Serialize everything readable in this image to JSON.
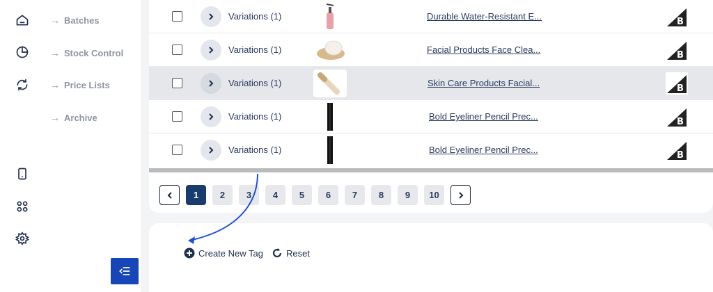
{
  "sidebar": {
    "items": [
      {
        "label": "Batches"
      },
      {
        "label": "Stock Control"
      },
      {
        "label": "Price Lists"
      },
      {
        "label": "Archive"
      }
    ],
    "arrow": "→"
  },
  "table": {
    "rows": [
      {
        "variations": "Variations (1)",
        "product": "Durable Water-Resistant E...",
        "highlight": false
      },
      {
        "variations": "Variations (1)",
        "product": "Facial Products Face Clea...",
        "highlight": false
      },
      {
        "variations": "Variations (1)",
        "product": "Skin Care Products Facial...",
        "highlight": true
      },
      {
        "variations": "Variations (1)",
        "product": "Bold Eyeliner Pencil Prec...",
        "highlight": false
      },
      {
        "variations": "Variations (1)",
        "product": "Bold Eyeliner Pencil Prec...",
        "highlight": false
      }
    ]
  },
  "pagination": {
    "pages": [
      "1",
      "2",
      "3",
      "4",
      "5",
      "6",
      "7",
      "8",
      "9",
      "10"
    ],
    "current": "1"
  },
  "actions": {
    "create_tag": "Create New Tag",
    "reset": "Reset"
  },
  "colors": {
    "accent": "#1746b8",
    "active_page": "#183c6e",
    "annotation_arrow": "#1f4fe0"
  }
}
